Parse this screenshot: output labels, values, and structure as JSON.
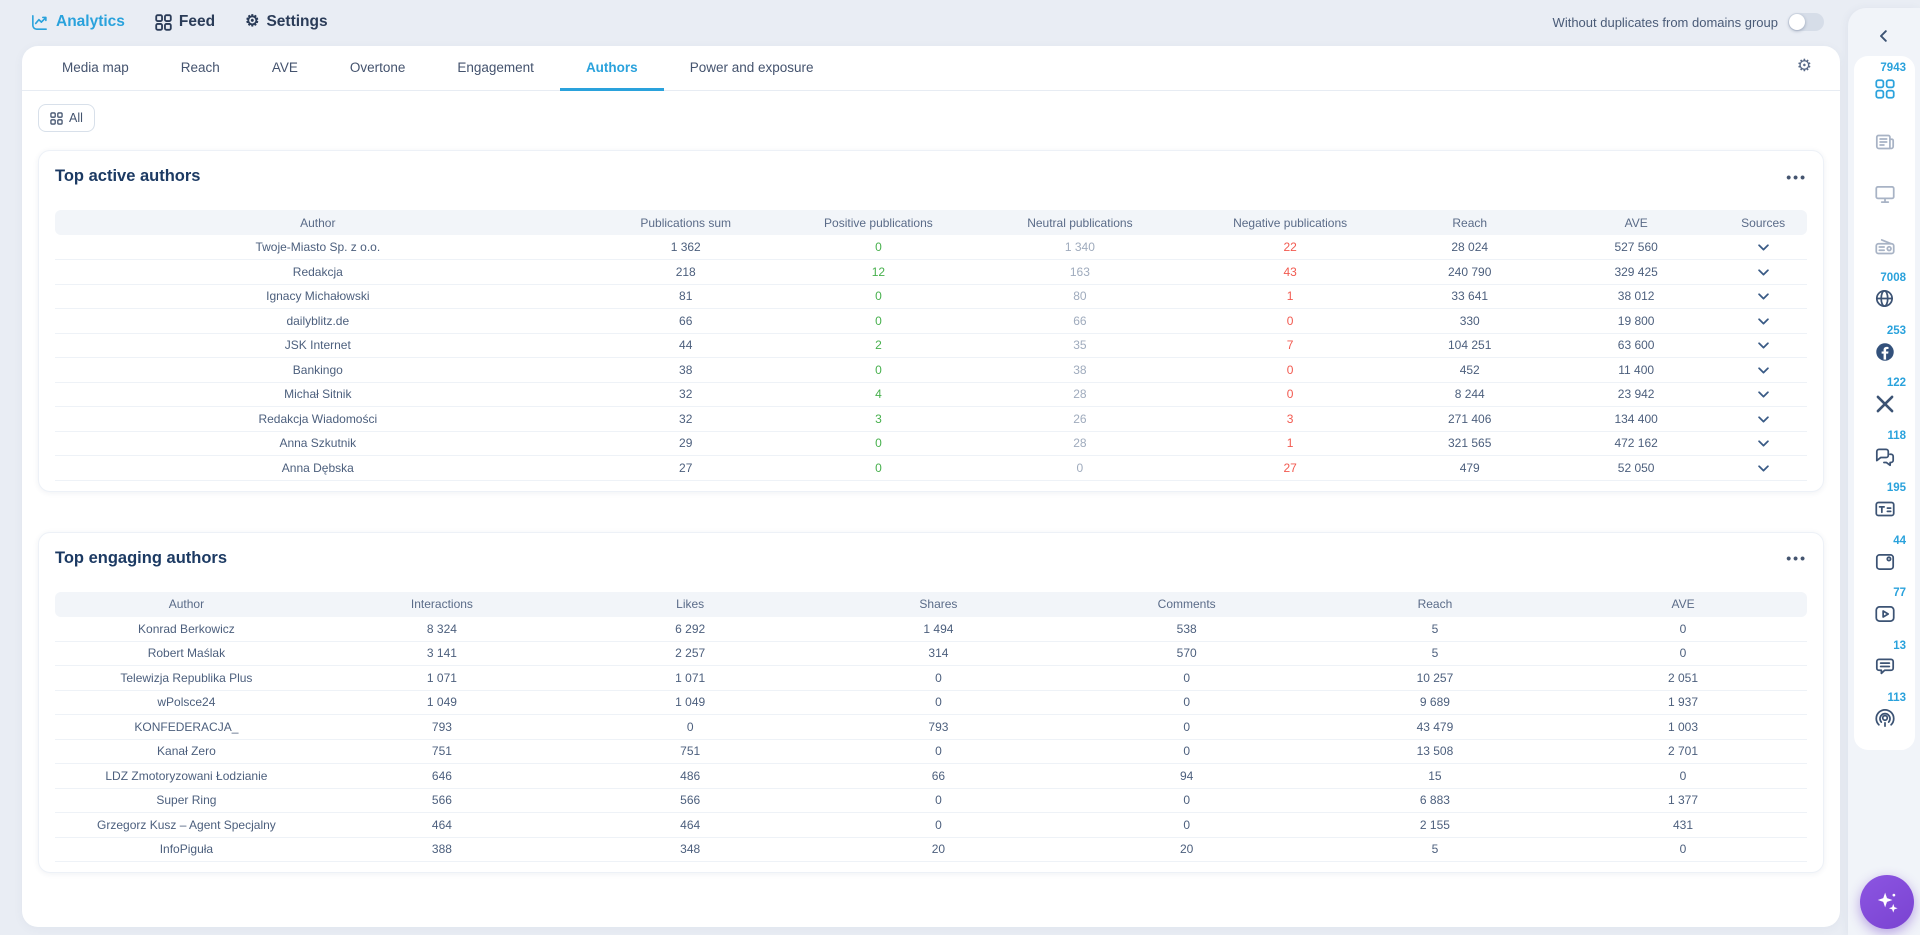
{
  "colors": {
    "accent": "#2aa2dc",
    "positive": "#47b04d",
    "negative": "#f25a50",
    "neutral": "#9fabbd",
    "fab_purple": "#7a43d1"
  },
  "topnav": {
    "items": [
      {
        "label": "Analytics",
        "icon": "line-chart-icon",
        "active": true
      },
      {
        "label": "Feed",
        "icon": "grid-icon",
        "active": false
      },
      {
        "label": "Settings",
        "icon": "gear-icon",
        "active": false
      }
    ],
    "duplicates_toggle": {
      "label": "Without duplicates from domains group",
      "state": "off"
    }
  },
  "tabs": {
    "items": [
      "Media map",
      "Reach",
      "AVE",
      "Overtone",
      "Engagement",
      "Authors",
      "Power and exposure"
    ],
    "active": "Authors"
  },
  "filter": {
    "all_label": "All"
  },
  "active_authors": {
    "title": "Top active authors",
    "menu_icon": "ellipsis-icon",
    "columns": [
      "Author",
      "Publications sum",
      "Positive publications",
      "Neutral publications",
      "Negative publications",
      "Reach",
      "AVE",
      "Sources"
    ],
    "rows": [
      [
        "Twoje-Miasto Sp. z o.o.",
        "1 362",
        "0",
        "1 340",
        "22",
        "28 024",
        "527 560"
      ],
      [
        "Redakcja",
        "218",
        "12",
        "163",
        "43",
        "240 790",
        "329 425"
      ],
      [
        "Ignacy Michałowski",
        "81",
        "0",
        "80",
        "1",
        "33 641",
        "38 012"
      ],
      [
        "dailyblitz.de",
        "66",
        "0",
        "66",
        "0",
        "330",
        "19 800"
      ],
      [
        "JSK Internet",
        "44",
        "2",
        "35",
        "7",
        "104 251",
        "63 600"
      ],
      [
        "Bankingo",
        "38",
        "0",
        "38",
        "0",
        "452",
        "11 400"
      ],
      [
        "Michał Sitnik",
        "32",
        "4",
        "28",
        "0",
        "8 244",
        "23 942"
      ],
      [
        "Redakcja Wiadomości",
        "32",
        "3",
        "26",
        "3",
        "271 406",
        "134 400"
      ],
      [
        "Anna Szkutnik",
        "29",
        "0",
        "28",
        "1",
        "321 565",
        "472 162"
      ],
      [
        "Anna Dębska",
        "27",
        "0",
        "0",
        "27",
        "479",
        "52 050"
      ]
    ]
  },
  "engaging_authors": {
    "title": "Top engaging authors",
    "menu_icon": "ellipsis-icon",
    "columns": [
      "Author",
      "Interactions",
      "Likes",
      "Shares",
      "Comments",
      "Reach",
      "AVE"
    ],
    "rows": [
      [
        "Konrad Berkowicz",
        "8 324",
        "6 292",
        "1 494",
        "538",
        "5",
        "0"
      ],
      [
        "Robert Maślak",
        "3 141",
        "2 257",
        "314",
        "570",
        "5",
        "0"
      ],
      [
        "Telewizja Republika Plus",
        "1 071",
        "1 071",
        "0",
        "0",
        "10 257",
        "2 051"
      ],
      [
        "wPolsce24",
        "1 049",
        "1 049",
        "0",
        "0",
        "9 689",
        "1 937"
      ],
      [
        "KONFEDERACJA_",
        "793",
        "0",
        "793",
        "0",
        "43 479",
        "1 003"
      ],
      [
        "Kanał Zero",
        "751",
        "751",
        "0",
        "0",
        "13 508",
        "2 701"
      ],
      [
        "LDZ Zmotoryzowani Łodzianie",
        "646",
        "486",
        "66",
        "94",
        "15",
        "0"
      ],
      [
        "Super Ring",
        "566",
        "566",
        "0",
        "0",
        "6 883",
        "1 377"
      ],
      [
        "Grzegorz Kusz – Agent Specjalny",
        "464",
        "464",
        "0",
        "0",
        "2 155",
        "431"
      ],
      [
        "InfoPiguła",
        "388",
        "348",
        "20",
        "20",
        "5",
        "0"
      ]
    ]
  },
  "sources_rail": {
    "collapse_icon": "chevron-left-icon",
    "items": [
      {
        "name": "all-sources",
        "icon": "grid-icon",
        "count": "7943",
        "state": "active"
      },
      {
        "name": "press",
        "icon": "newspaper-icon",
        "count": "",
        "state": "dim"
      },
      {
        "name": "tv",
        "icon": "monitor-icon",
        "count": "",
        "state": "dim"
      },
      {
        "name": "radio",
        "icon": "radio-icon",
        "count": "",
        "state": "dim"
      },
      {
        "name": "internet",
        "icon": "globe-icon",
        "count": "7008",
        "state": "normal"
      },
      {
        "name": "facebook",
        "icon": "facebook-icon",
        "count": "253",
        "state": "normal"
      },
      {
        "name": "x-twitter",
        "icon": "x-icon",
        "count": "122",
        "state": "normal"
      },
      {
        "name": "social-chat",
        "icon": "chat-icon",
        "count": "118",
        "state": "normal"
      },
      {
        "name": "articles",
        "icon": "text-card-icon",
        "count": "195",
        "state": "normal"
      },
      {
        "name": "images",
        "icon": "image-icon",
        "count": "44",
        "state": "normal"
      },
      {
        "name": "videos",
        "icon": "video-icon",
        "count": "77",
        "state": "normal"
      },
      {
        "name": "comments",
        "icon": "comment-icon",
        "count": "13",
        "state": "normal"
      },
      {
        "name": "podcasts",
        "icon": "podcast-icon",
        "count": "113",
        "state": "normal"
      }
    ]
  },
  "fab": {
    "icon": "sparkles-icon"
  }
}
